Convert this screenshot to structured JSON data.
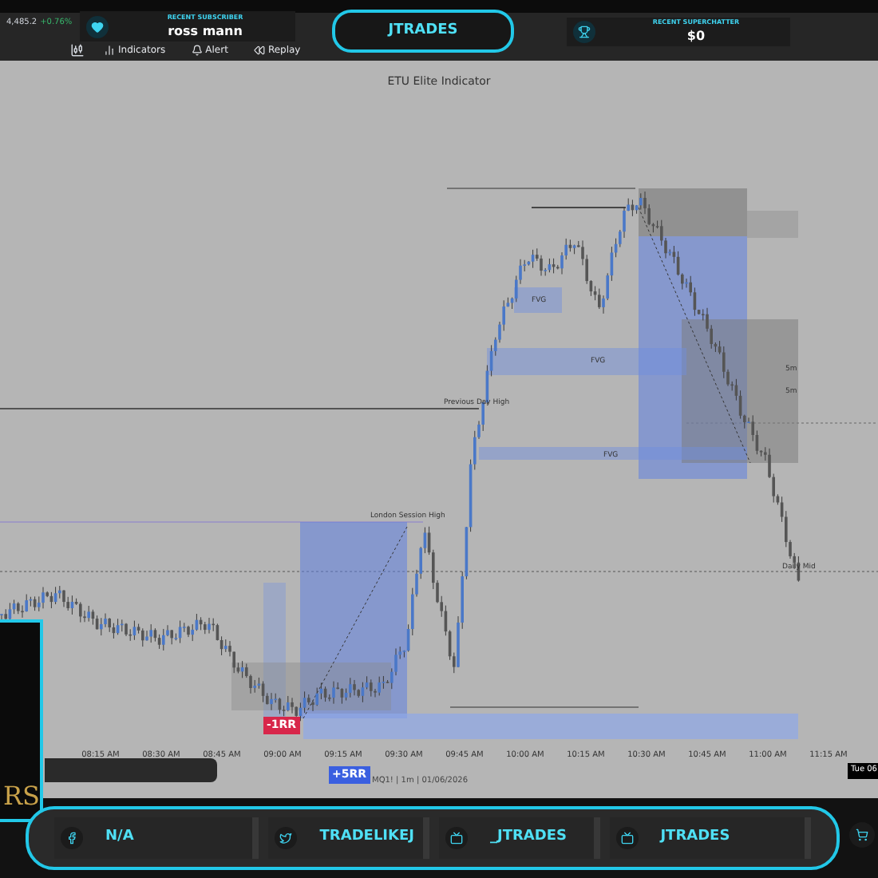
{
  "top_bar": {
    "quote": {
      "price": "4,485.2",
      "change": "+0.76%"
    },
    "toolbar": [
      {
        "label": "Indicators",
        "kind": "indicators"
      },
      {
        "label": "Alert",
        "kind": "alert"
      },
      {
        "label": "Replay",
        "kind": "replay"
      }
    ],
    "recent_subscriber": {
      "heading": "RECENT SUBSCRIBER",
      "name": "ross mann"
    },
    "brand": "JTRADES",
    "recent_superchatter": {
      "heading": "RECENT SUPERCHATTER",
      "amount": "$0"
    }
  },
  "chart": {
    "title": "ETU Elite Indicator",
    "labels": [
      {
        "text": "Previous Day High"
      },
      {
        "text": "London Session High"
      },
      {
        "text": "FVG"
      },
      {
        "text": "FVG"
      },
      {
        "text": "FVG"
      },
      {
        "text": "5m"
      },
      {
        "text": "5m"
      },
      {
        "text": "Daily Mid"
      }
    ],
    "badges": [
      {
        "text": "-1RR",
        "kind": "loss"
      },
      {
        "text": "+5RR",
        "kind": "gain"
      }
    ],
    "symbol_info": "MQ1! | 1m | 01/06/2026",
    "time_axis": [
      "08:15 AM",
      "08:30 AM",
      "08:45 AM",
      "09:00 AM",
      "09:15 AM",
      "09:30 AM",
      "09:45 AM",
      "10:00 AM",
      "10:15 AM",
      "10:30 AM",
      "10:45 AM",
      "11:00 AM",
      "11:15 AM"
    ],
    "tooltip": "Tue 06"
  },
  "side_panel": {
    "text": "RS"
  },
  "socials": [
    {
      "kind": "facebook",
      "handle": "N/A"
    },
    {
      "kind": "twitter",
      "handle": "TRADELIKEJ"
    },
    {
      "kind": "video",
      "handle": "_JTRADES"
    },
    {
      "kind": "video",
      "handle": "JTRADES"
    }
  ]
}
